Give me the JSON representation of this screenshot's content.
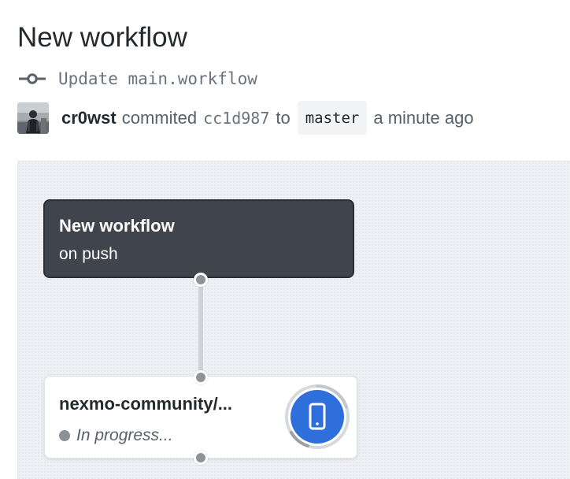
{
  "page": {
    "title": "New workflow"
  },
  "commit": {
    "icon": "commit-icon",
    "message": "Update main.workflow",
    "author": "cr0wst",
    "verb": "commited",
    "sha": "cc1d987",
    "preposition": "to",
    "branch": "master",
    "time": "a minute ago"
  },
  "workflow": {
    "trigger": {
      "title": "New workflow",
      "event": "on push"
    },
    "action": {
      "title": "nexmo-community/...",
      "status": "In progress...",
      "icon": "mobile-device-icon"
    }
  },
  "colors": {
    "canvas": "#eef0f4",
    "trigger_node": "#3f444d",
    "action_icon": "#2f6fdc",
    "status_dot": "#8b9097"
  }
}
